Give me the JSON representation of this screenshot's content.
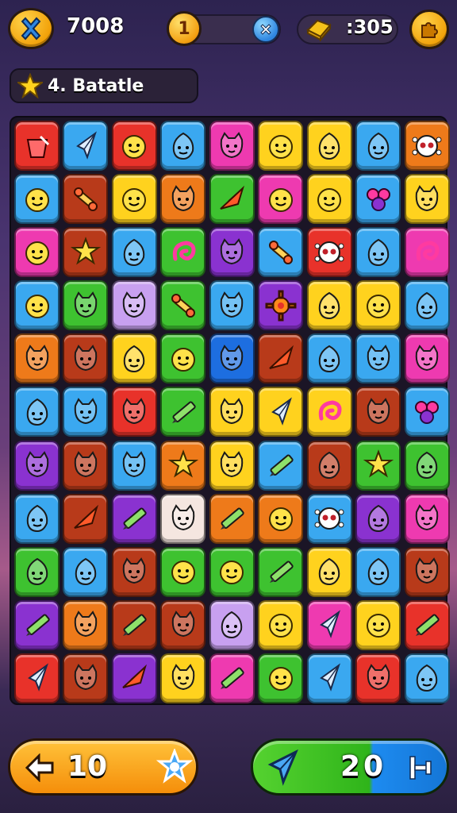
{
  "hud": {
    "score": "7008",
    "lives": "1",
    "gold": ":305"
  },
  "banner": {
    "label": "4. Batatle"
  },
  "board": {
    "rows": [
      [
        [
          "#e8322a",
          "bucket"
        ],
        [
          "#3aa8f0",
          "rocket"
        ],
        [
          "#e8322a",
          "face"
        ],
        [
          "#3aa8f0",
          "blob"
        ],
        [
          "#ee3ab0",
          "cat"
        ],
        [
          "#ffd21e",
          "face"
        ],
        [
          "#ffd21e",
          "blob"
        ],
        [
          "#3aa8f0",
          "blob"
        ],
        [
          "#ee7a1a",
          "skull"
        ]
      ],
      [
        [
          "#3aa8f0",
          "face"
        ],
        [
          "#b83a1a",
          "bone"
        ],
        [
          "#ffd21e",
          "face"
        ],
        [
          "#ee7a1a",
          "cat"
        ],
        [
          "#3ec230",
          "plane"
        ],
        [
          "#ee3ab0",
          "face"
        ],
        [
          "#ffd21e",
          "face"
        ],
        [
          "#3aa8f0",
          "flower"
        ],
        [
          "#ffd21e",
          "cat"
        ]
      ],
      [
        [
          "#ee3ab0",
          "face"
        ],
        [
          "#b83a1a",
          "star"
        ],
        [
          "#3aa8f0",
          "blob"
        ],
        [
          "#3ec230",
          "swirl"
        ],
        [
          "#8a32d0",
          "cat"
        ],
        [
          "#3aa8f0",
          "bone"
        ],
        [
          "#e8322a",
          "skull"
        ],
        [
          "#3aa8f0",
          "blob"
        ],
        [
          "#ee3ab0",
          "swirl"
        ]
      ],
      [
        [
          "#3aa8f0",
          "face"
        ],
        [
          "#3ec230",
          "cat"
        ],
        [
          "#c8a0f0",
          "cat"
        ],
        [
          "#3ec230",
          "bone"
        ],
        [
          "#3aa8f0",
          "cat"
        ],
        [
          "#8a32d0",
          "gear"
        ],
        [
          "#ffd21e",
          "blob"
        ],
        [
          "#ffd21e",
          "face"
        ],
        [
          "#3aa8f0",
          "blob"
        ]
      ],
      [
        [
          "#ee7a1a",
          "cat"
        ],
        [
          "#b83a1a",
          "cat"
        ],
        [
          "#ffd21e",
          "blob"
        ],
        [
          "#3ec230",
          "face"
        ],
        [
          "#1d6ee0",
          "cat"
        ],
        [
          "#b83a1a",
          "plane"
        ],
        [
          "#3aa8f0",
          "blob"
        ],
        [
          "#3aa8f0",
          "cat"
        ],
        [
          "#ee3ab0",
          "cat"
        ]
      ],
      [
        [
          "#3aa8f0",
          "blob"
        ],
        [
          "#3aa8f0",
          "cat"
        ],
        [
          "#e8322a",
          "cat"
        ],
        [
          "#3ec230",
          "pencil"
        ],
        [
          "#ffd21e",
          "cat"
        ],
        [
          "#ffd21e",
          "rocket"
        ],
        [
          "#ffd21e",
          "swirl"
        ],
        [
          "#b83a1a",
          "cat"
        ],
        [
          "#3aa8f0",
          "flower"
        ]
      ],
      [
        [
          "#8a32d0",
          "cat"
        ],
        [
          "#b83a1a",
          "cat"
        ],
        [
          "#3aa8f0",
          "cat"
        ],
        [
          "#ee7a1a",
          "star"
        ],
        [
          "#ffd21e",
          "cat"
        ],
        [
          "#3aa8f0",
          "pencil"
        ],
        [
          "#b83a1a",
          "blob"
        ],
        [
          "#3ec230",
          "star"
        ],
        [
          "#3ec230",
          "blob"
        ]
      ],
      [
        [
          "#3aa8f0",
          "blob"
        ],
        [
          "#b83a1a",
          "plane"
        ],
        [
          "#8a32d0",
          "pencil"
        ],
        [
          "#f5e6e0",
          "cat"
        ],
        [
          "#ee7a1a",
          "pencil"
        ],
        [
          "#ee7a1a",
          "face"
        ],
        [
          "#3aa8f0",
          "skull"
        ],
        [
          "#8a32d0",
          "blob"
        ],
        [
          "#ee3ab0",
          "cat"
        ]
      ],
      [
        [
          "#3ec230",
          "blob"
        ],
        [
          "#3aa8f0",
          "blob"
        ],
        [
          "#b83a1a",
          "cat"
        ],
        [
          "#3ec230",
          "face"
        ],
        [
          "#3ec230",
          "face"
        ],
        [
          "#3ec230",
          "pencil"
        ],
        [
          "#ffd21e",
          "blob"
        ],
        [
          "#3aa8f0",
          "blob"
        ],
        [
          "#b83a1a",
          "cat"
        ]
      ],
      [
        [
          "#8a32d0",
          "pencil"
        ],
        [
          "#ee7a1a",
          "cat"
        ],
        [
          "#b83a1a",
          "pencil"
        ],
        [
          "#b83a1a",
          "cat"
        ],
        [
          "#c8a0f0",
          "blob"
        ],
        [
          "#ffd21e",
          "face"
        ],
        [
          "#ee3ab0",
          "rocket"
        ],
        [
          "#ffd21e",
          "face"
        ],
        [
          "#e8322a",
          "pencil"
        ]
      ],
      [
        [
          "#e8322a",
          "rocket"
        ],
        [
          "#b83a1a",
          "cat"
        ],
        [
          "#8a32d0",
          "plane"
        ],
        [
          "#ffd21e",
          "cat"
        ],
        [
          "#ee3ab0",
          "pencil"
        ],
        [
          "#3ec230",
          "face"
        ],
        [
          "#3aa8f0",
          "rocket"
        ],
        [
          "#e8322a",
          "cat"
        ],
        [
          "#3aa8f0",
          "blob"
        ]
      ]
    ]
  },
  "bottom": {
    "moves": "10",
    "target": "20"
  }
}
